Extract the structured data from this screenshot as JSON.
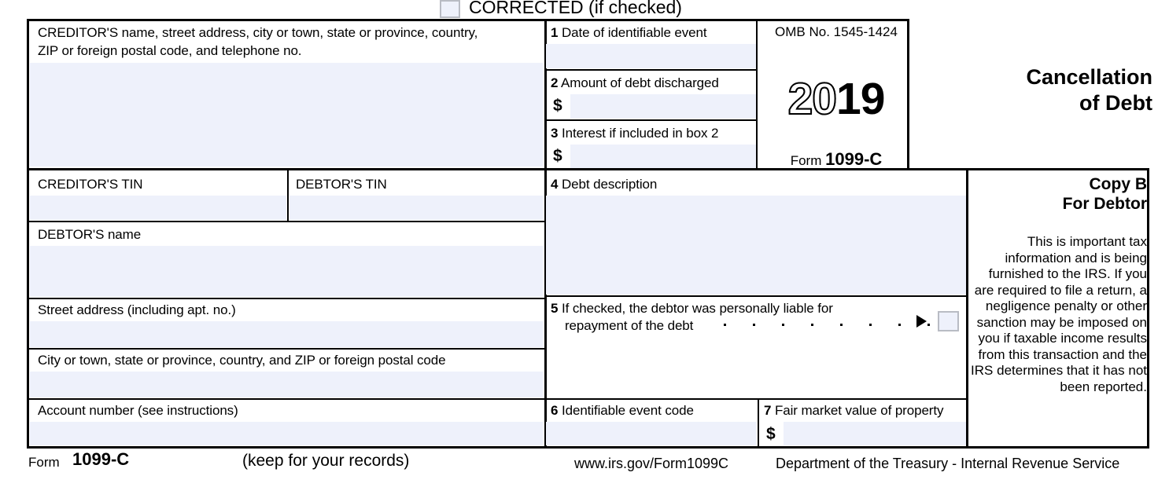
{
  "header": {
    "corrected_label": "CORRECTED (if checked)",
    "corrected_checkbox": "unchecked"
  },
  "colors": {
    "field_fill": "#eef1fb",
    "rule": "#000000",
    "checkbox_border": "#b9bcc4"
  },
  "creditor": {
    "label_line1": "CREDITOR'S name, street address, city or town, state or province, country,",
    "label_line2": "ZIP or foreign postal code, and telephone no.",
    "value": ""
  },
  "boxes": {
    "box1": {
      "number": "1",
      "label": "Date of identifiable event",
      "value": ""
    },
    "box2": {
      "number": "2",
      "label": "Amount of debt discharged",
      "currency": "$",
      "value": ""
    },
    "box3": {
      "number": "3",
      "label": "Interest if included in box 2",
      "currency": "$",
      "value": ""
    },
    "box4": {
      "number": "4",
      "label": "Debt description",
      "value": ""
    },
    "box5": {
      "number": "5",
      "label_line1": "If checked, the debtor was personally liable for",
      "label_line2": "repayment of the debt",
      "leader_dots": 8,
      "checkbox": "unchecked"
    },
    "box6": {
      "number": "6",
      "label": "Identifiable event code",
      "value": ""
    },
    "box7": {
      "number": "7",
      "label": "Fair market value of property",
      "currency": "$",
      "value": ""
    }
  },
  "omb": {
    "number_line": "OMB No. 1545-1424",
    "year_prefix": "20",
    "year_suffix": "19",
    "form_prefix": "Form",
    "form_number": "1099-C"
  },
  "title": {
    "line1": "Cancellation",
    "line2": "of Debt"
  },
  "copy": {
    "heading_line1": "Copy B",
    "heading_line2": "For Debtor",
    "body": "This is important tax information and is being furnished to the IRS. If you are required to file a return, a negligence penalty or other sanction may be imposed on you if taxable income results from this transaction and the IRS determines that it has not been reported."
  },
  "tins": {
    "creditor_tin_label": "CREDITOR'S TIN",
    "creditor_tin_value": "",
    "debtor_tin_label": "DEBTOR'S TIN",
    "debtor_tin_value": ""
  },
  "debtor": {
    "name_label": "DEBTOR'S name",
    "name_value": "",
    "street_label": "Street address (including apt. no.)",
    "street_value": "",
    "city_label": "City or town, state or province, country, and ZIP or foreign postal code",
    "city_value": ""
  },
  "account": {
    "label": "Account number (see instructions)",
    "value": ""
  },
  "footer": {
    "form_label": "Form",
    "form_number": "1099-C",
    "keep_note": "(keep for your records)",
    "url": "www.irs.gov/Form1099C",
    "department": "Department of the Treasury - Internal Revenue Service"
  }
}
